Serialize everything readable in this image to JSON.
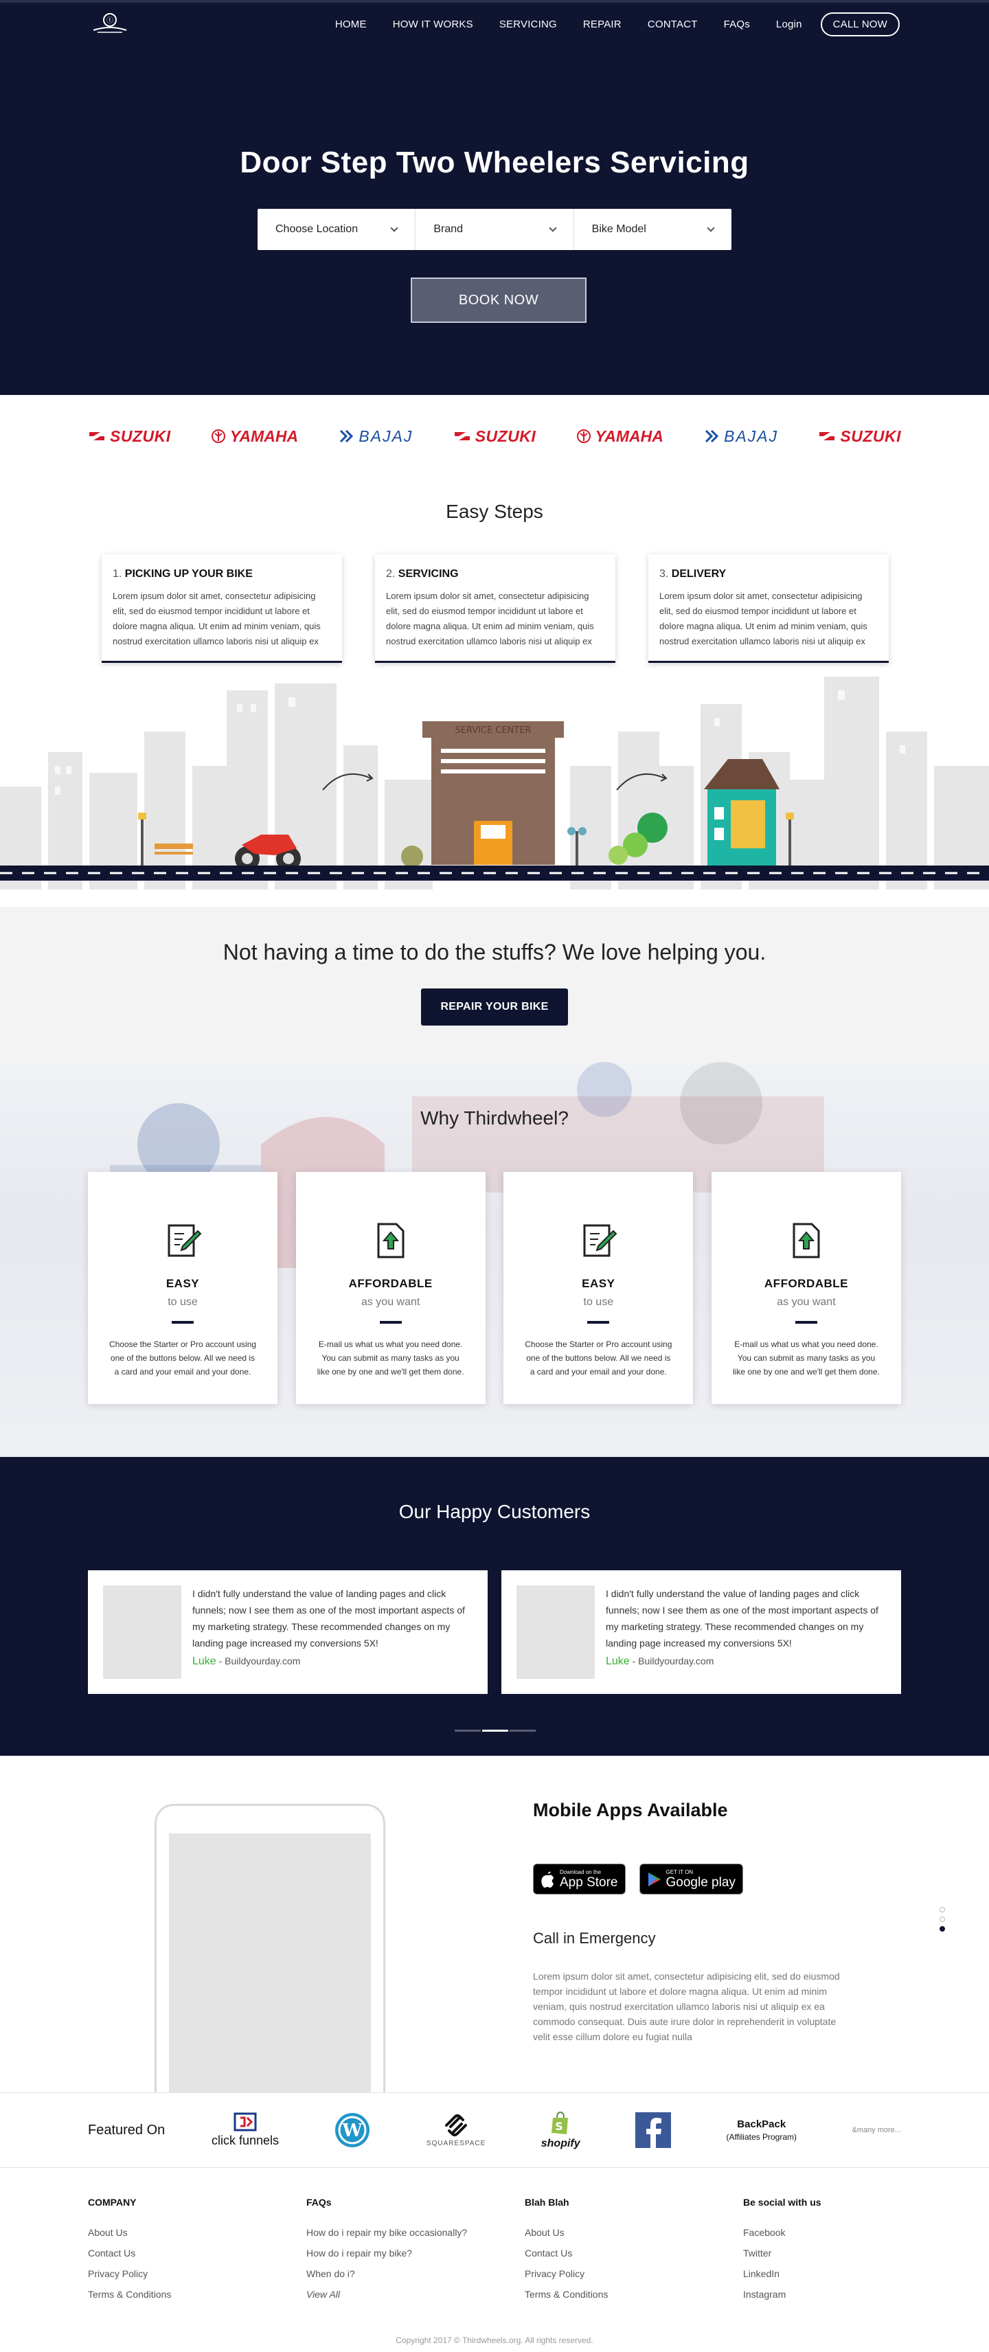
{
  "nav": {
    "items": [
      "HOME",
      "HOW IT WORKS",
      "SERVICING",
      "REPAIR",
      "CONTACT",
      "FAQs",
      "Login"
    ],
    "call_label": "CALL NOW"
  },
  "hero": {
    "title": "Door Step Two Wheelers Servicing",
    "selects": [
      "Choose Location",
      "Brand",
      "Bike Model"
    ],
    "book_label": "BOOK NOW"
  },
  "brands": [
    "SUZUKI",
    "YAMAHA",
    "BAJAJ",
    "SUZUKI",
    "YAMAHA",
    "BAJAJ",
    "SUZUKI"
  ],
  "easy": {
    "title": "Easy Steps",
    "steps": [
      {
        "num": "1.",
        "title": "PICKING UP YOUR BIKE",
        "text": "Lorem ipsum dolor sit amet, consectetur adipisicing elit, sed do eiusmod tempor incididunt ut labore et dolore magna aliqua. Ut enim ad minim veniam, quis nostrud exercitation ullamco laboris nisi ut aliquip ex"
      },
      {
        "num": "2.",
        "title": "SERVICING",
        "text": "Lorem ipsum dolor sit amet, consectetur adipisicing elit, sed do eiusmod tempor incididunt ut labore et dolore magna aliqua. Ut enim ad minim veniam, quis nostrud exercitation ullamco laboris nisi ut aliquip ex"
      },
      {
        "num": "3.",
        "title": "DELIVERY",
        "text": "Lorem ipsum dolor sit amet, consectetur adipisicing elit, sed do eiusmod tempor incididunt ut labore et dolore magna aliqua. Ut enim ad minim veniam, quis nostrud exercitation ullamco laboris nisi ut aliquip ex"
      }
    ],
    "service_center_label": "SERVICE CENTER"
  },
  "help": {
    "title": "Not having a time to do the stuffs? We love helping you.",
    "button": "REPAIR YOUR BIKE"
  },
  "why": {
    "title": "Why Thirdwheel?",
    "cards": [
      {
        "icon": "edit-document-icon",
        "title": "EASY",
        "sub": "to use",
        "text": "Choose the Starter or Pro account using one of the buttons below. All we need is a card and your email and your done."
      },
      {
        "icon": "upload-document-icon",
        "title": "AFFORDABLE",
        "sub": "as you want",
        "text": "E-mail us what us what you need done. You can submit as many tasks as you like one by one and we'll get them done."
      },
      {
        "icon": "edit-document-icon",
        "title": "EASY",
        "sub": "to use",
        "text": "Choose the Starter or Pro account using one of the buttons below. All we need is a card and your email and your done."
      },
      {
        "icon": "upload-document-icon",
        "title": "AFFORDABLE",
        "sub": "as you want",
        "text": "E-mail us what us what you need done. You can submit as many tasks as you like one by one and we'll get them done."
      }
    ]
  },
  "customers": {
    "title": "Our Happy Customers",
    "items": [
      {
        "quote": "I didn't fully understand the value of landing pages and click funnels; now I see them as one of the most important aspects of my marketing strategy. These recommended changes on my landing page increased my conversions 5X!",
        "name": "Luke",
        "site": " - Buildyourday.com"
      },
      {
        "quote": "I didn't fully understand the value of landing pages and click funnels; now I see them as one of the most important aspects of my marketing strategy. These recommended changes on my landing page increased my conversions 5X!",
        "name": "Luke",
        "site": " - Buildyourday.com"
      }
    ]
  },
  "mobile": {
    "title": "Mobile Apps Available",
    "appstore_small": "Download on the",
    "appstore_big": "App Store",
    "googleplay_small": "GET IT ON",
    "googleplay_big": "Google play",
    "emergency": "Call in Emergency",
    "text": "Lorem ipsum dolor sit amet, consectetur adipisicing elit, sed do eiusmod tempor incididunt ut labore et dolore magna aliqua. Ut enim ad minim veniam, quis nostrud exercitation ullamco laboris nisi ut aliquip ex ea commodo consequat. Duis aute irure dolor in reprehenderit in voluptate velit esse cillum dolore eu fugiat nulla"
  },
  "featured": {
    "label": "Featured On",
    "clickfunnels": "click funnels",
    "squarespace": "SQUARESPACE",
    "shopify": "shopify",
    "backpack": "BackPack",
    "backpack_sub": "(Affiliates Program)",
    "more": "&many more..."
  },
  "footer": {
    "cols": [
      {
        "title": "COMPANY",
        "links": [
          "About Us",
          "Contact Us",
          "Privacy Policy",
          "Terms & Conditions"
        ]
      },
      {
        "title": "FAQs",
        "links": [
          "How do i repair my  bike occasionally?",
          "How do i repair my  bike?",
          "When do i?",
          "View All"
        ]
      },
      {
        "title": "Blah Blah",
        "links": [
          "About Us",
          "Contact Us",
          "Privacy Policy",
          "Terms & Conditions"
        ]
      },
      {
        "title": "Be social with us",
        "links": [
          "Facebook",
          "Twitter",
          "LinkedIn",
          "Instagram"
        ]
      }
    ],
    "copyright": "Copyright 2017 © Thirdwheels.org. All rights reserved."
  },
  "colors": {
    "navy": "#0f1430",
    "accent_green": "#35b030",
    "brand_red": "#d41a2a",
    "brand_blue": "#1a4fa3"
  }
}
